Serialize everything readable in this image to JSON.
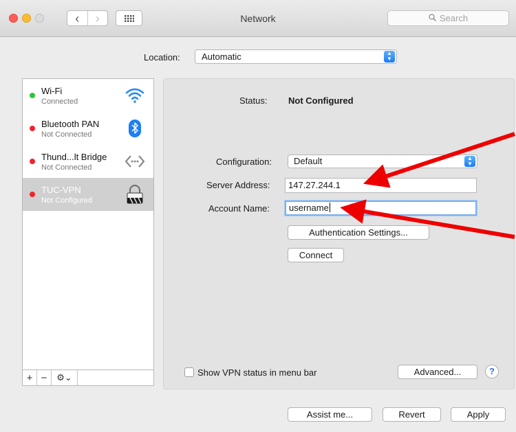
{
  "window": {
    "title": "Network",
    "search_placeholder": "Search",
    "nav_back": "‹",
    "nav_forward": "›"
  },
  "location": {
    "label": "Location:",
    "value": "Automatic"
  },
  "services": [
    {
      "name": "Wi-Fi",
      "status": "Connected",
      "status_color": "#2ec636",
      "icon": "wifi-icon",
      "selected": false
    },
    {
      "name": "Bluetooth PAN",
      "status": "Not Connected",
      "status_color": "#f0232c",
      "icon": "bluetooth-icon",
      "selected": false
    },
    {
      "name": "Thund...lt Bridge",
      "status": "Not Connected",
      "status_color": "#f0232c",
      "icon": "thunderbolt-bridge-icon",
      "selected": false
    },
    {
      "name": "TUC-VPN",
      "status": "Not Configured",
      "status_color": "#f0232c",
      "icon": "vpn-lock-icon",
      "selected": true
    }
  ],
  "sidebar_tools": {
    "add": "+",
    "remove": "−",
    "gear": "⚙⌄"
  },
  "detail": {
    "status_label": "Status:",
    "status_value": "Not Configured",
    "configuration_label": "Configuration:",
    "configuration_value": "Default",
    "server_label": "Server Address:",
    "server_value": "147.27.244.1",
    "account_label": "Account Name:",
    "account_value": "username",
    "auth_button": "Authentication Settings...",
    "connect_button": "Connect",
    "show_vpn_label": "Show VPN status in menu bar",
    "show_vpn_checked": false,
    "advanced_button": "Advanced...",
    "help_button": "?"
  },
  "footer": {
    "assist_button": "Assist me...",
    "revert_button": "Revert",
    "apply_button": "Apply"
  },
  "colors": {
    "accent": "#1c7cf3",
    "connected": "#2ec636",
    "disconnected": "#f0232c",
    "annotation_arrow": "#ee0000",
    "selected_row": "#d0d0d0"
  }
}
